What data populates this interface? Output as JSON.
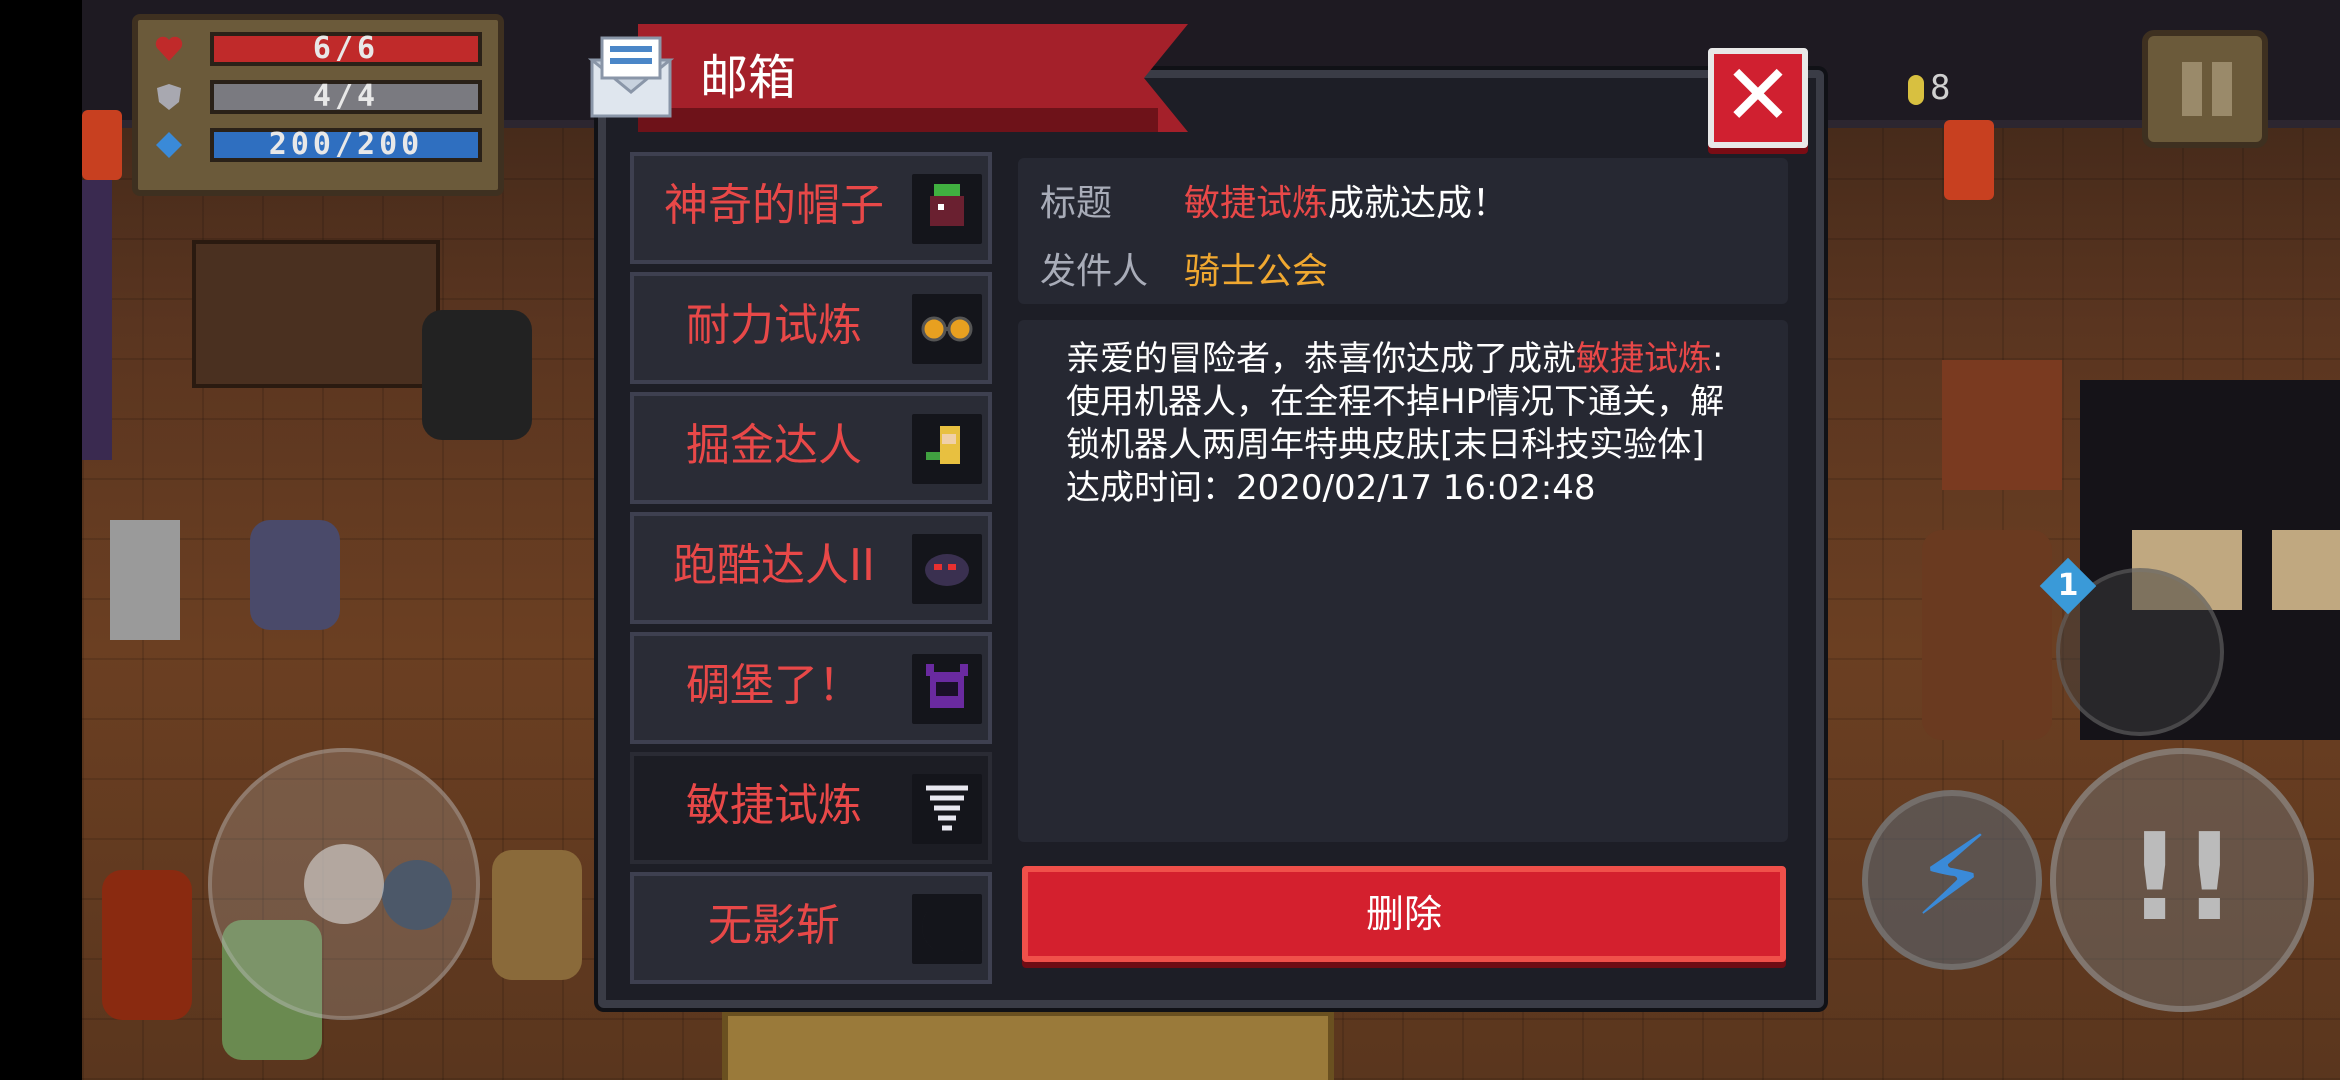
{
  "hud": {
    "health": "6/6",
    "armor": "4/4",
    "energy": "200/200",
    "coins": "8",
    "weapon_slot_badge": "1"
  },
  "colors": {
    "dialog_bg": "#1d1e26",
    "header_red": "#a4202a",
    "highlight_red": "#e84848",
    "sender_gold": "#f0a830",
    "delete_red": "#d4202e"
  },
  "mailbox": {
    "title": "邮箱",
    "close_label": "✕",
    "items": [
      {
        "label": "神奇的帽子",
        "icon": "hat-character-icon"
      },
      {
        "label": "耐力试炼",
        "icon": "goggles-icon"
      },
      {
        "label": "掘金达人",
        "icon": "gold-digger-character-icon"
      },
      {
        "label": "跑酷达人II",
        "icon": "parkour-monster-icon"
      },
      {
        "label": "碉堡了！",
        "icon": "purple-monster-icon"
      },
      {
        "label": "敏捷试炼",
        "icon": "tornado-icon"
      },
      {
        "label": "无影斩",
        "icon": "crescent-slash-icon"
      }
    ],
    "selected_index": 5,
    "detail": {
      "subject_label": "标题",
      "subject_highlight": "敏捷试炼",
      "subject_rest": "成就达成！",
      "sender_label": "发件人",
      "sender": "骑士公会",
      "body_prefix": "亲爱的冒险者，恭喜你达成了成就",
      "body_highlight": "敏捷试炼",
      "body_rest": ":使用机器人，在全程不掉HP情况下通关，解锁机器人两周年特典皮肤[末日科技实验体]",
      "achieved_time": "达成时间：2020/02/17 16:02:48"
    },
    "delete_label": "删除"
  }
}
